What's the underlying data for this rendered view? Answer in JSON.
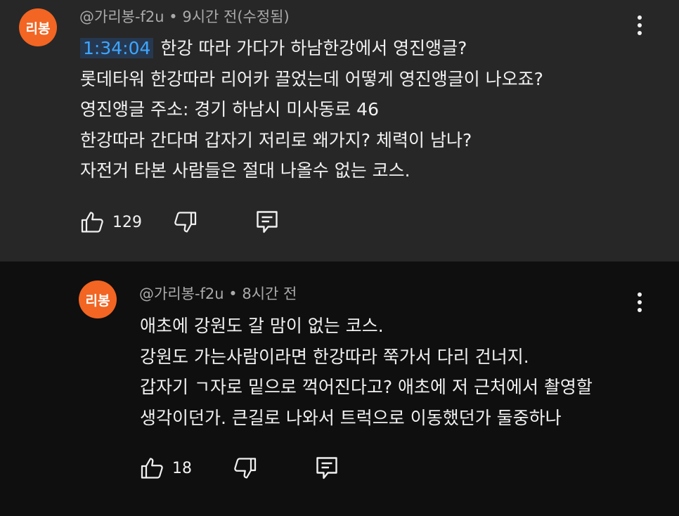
{
  "comments": [
    {
      "avatar_text": "리봉",
      "meta": "@가리봉-f2u • 9시간 전(수정됨)",
      "timestamp": "1:34:04",
      "lines": [
        "한강 따라 가다가 하남한강에서  영진앵글?",
        "롯데타워 한강따라 리어카 끌었는데 어떻게 영진앵글이 나오죠?",
        "영진앵글 주소: 경기 하남시 미사동로 46",
        "한강따라 간다며 갑자기 저리로 왜가지? 체력이 남나?",
        "자전거 타본 사람들은 절대 나올수 없는 코스."
      ],
      "like_count": "129",
      "icons": {
        "like": "thumbs-up-icon",
        "dislike": "thumbs-down-icon",
        "reply": "reply-icon",
        "menu": "more-vert-icon"
      }
    },
    {
      "avatar_text": "리봉",
      "meta": "@가리봉-f2u • 8시간 전",
      "lines": [
        "애초에 강원도 갈 맘이 없는 코스.",
        "강원도 가는사람이라면 한강따라 쭉가서 다리 건너지.",
        "갑자기 ㄱ자로 밑으로 꺽어진다고? 애초에 저 근처에서 촬영할",
        "생각이던가. 큰길로 나와서 트럭으로 이동했던가 둘중하나"
      ],
      "like_count": "18",
      "icons": {
        "like": "thumbs-up-icon",
        "dislike": "thumbs-down-icon",
        "reply": "reply-icon",
        "menu": "more-vert-icon"
      }
    }
  ],
  "colors": {
    "avatar": "#f26522",
    "timestamp": "#3ea6ff",
    "top_bg": "#272727",
    "bottom_bg": "#0f0f0f"
  }
}
